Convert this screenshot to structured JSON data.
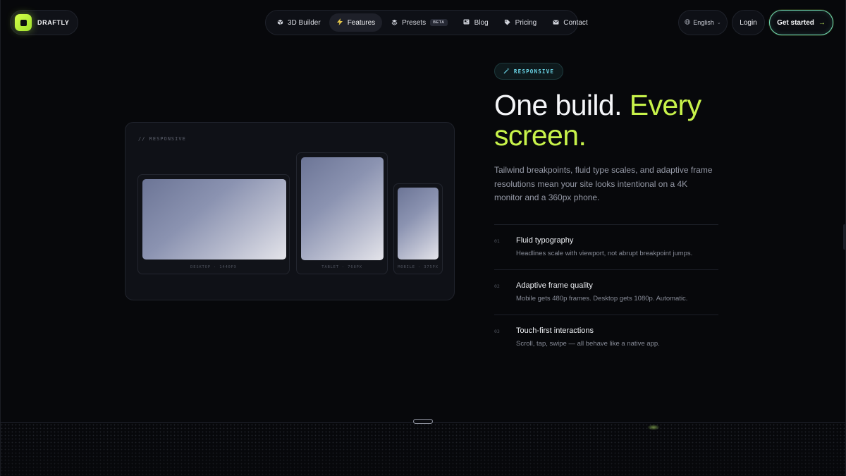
{
  "brand": {
    "name": "DRAFTLY",
    "accent": "#c7f24a",
    "icon": "logo-square-icon"
  },
  "nav": {
    "items": [
      {
        "label": "3D Builder",
        "icon": "cube-icon",
        "active": false
      },
      {
        "label": "Features",
        "icon": "lightning-icon",
        "active": true
      },
      {
        "label": "Presets",
        "icon": "layers-icon",
        "active": false,
        "badge": "BETA"
      },
      {
        "label": "Blog",
        "icon": "newspaper-icon",
        "active": false
      },
      {
        "label": "Pricing",
        "icon": "tag-icon",
        "active": false
      },
      {
        "label": "Contact",
        "icon": "mail-icon",
        "active": false
      }
    ],
    "language": "English",
    "login": "Login",
    "cta": "Get started"
  },
  "showcase": {
    "label": "// RESPONSIVE",
    "devices": [
      {
        "label": "DESKTOP · 1440PX"
      },
      {
        "label": "TABLET · 768PX"
      },
      {
        "label": "MOBILE · 375PX"
      }
    ]
  },
  "hero": {
    "tag": "RESPONSIVE",
    "headline_white": "One build.",
    "headline_accent_1": "Every",
    "headline_accent_2": "screen.",
    "lead": "Tailwind breakpoints, fluid type scales, and adaptive frame resolutions mean your site looks intentional on a 4K monitor and a 360px phone."
  },
  "features": [
    {
      "num": "01",
      "title": "Fluid typography",
      "desc": "Headlines scale with viewport, not abrupt breakpoint jumps."
    },
    {
      "num": "02",
      "title": "Adaptive frame quality",
      "desc": "Mobile gets 480p frames. Desktop gets 1080p. Automatic."
    },
    {
      "num": "03",
      "title": "Touch-first interactions",
      "desc": "Scroll, tap, swipe — all behave like a native app."
    }
  ]
}
